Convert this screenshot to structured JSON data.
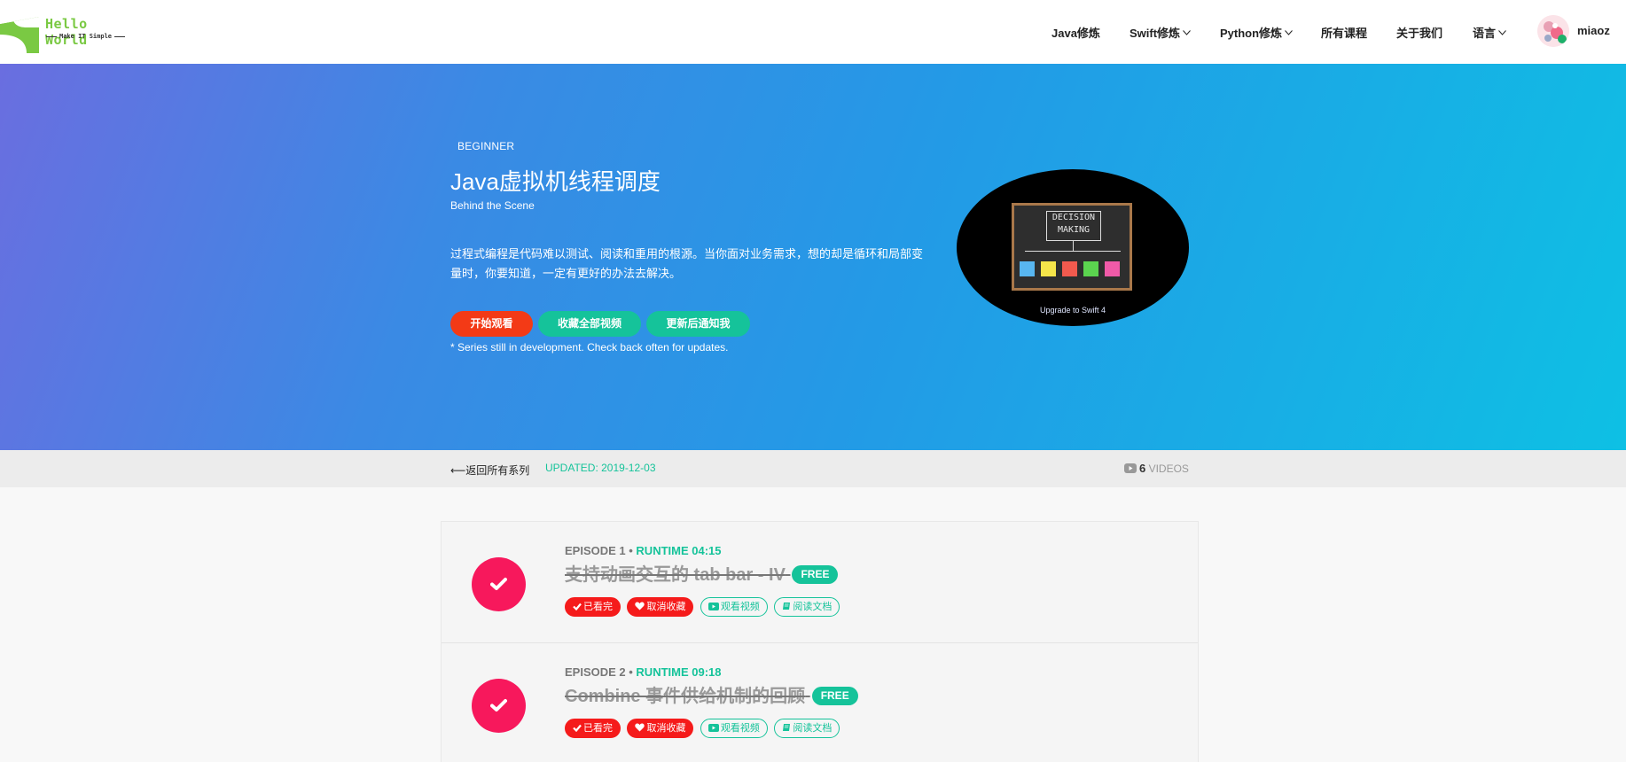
{
  "brand": {
    "name": "Hello World",
    "tagline": "Make IT Simple"
  },
  "nav": {
    "items": [
      {
        "label": "Java修炼",
        "dropdown": false
      },
      {
        "label": "Swift修炼",
        "dropdown": true
      },
      {
        "label": "Python修炼",
        "dropdown": true
      },
      {
        "label": "所有课程",
        "dropdown": false
      },
      {
        "label": "关于我们",
        "dropdown": false
      },
      {
        "label": "语言",
        "dropdown": true
      }
    ],
    "user": "miaoz"
  },
  "hero": {
    "level": "BEGINNER",
    "title": "Java虚拟机线程调度",
    "subtitle": "Behind the Scene",
    "description": "过程式编程是代码难以测试、阅读和重用的根源。当你面对业务需求，想的却是循环和局部变量时，你要知道，一定有更好的办法去解决。",
    "buttons": {
      "start": "开始观看",
      "favorite_all": "收藏全部视频",
      "notify": "更新后通知我"
    },
    "note": "* Series still in development. Check back often for updates.",
    "thumbnail": {
      "board_text": "DECISION MAKING",
      "caption": "Upgrade to Swift 4"
    }
  },
  "series_bar": {
    "back": "⟵返回所有系列",
    "updated": "UPDATED: 2019-12-03",
    "video_count": "6",
    "videos_label": "VIDEOS"
  },
  "episodes": [
    {
      "episode": "EPISODE 1",
      "runtime": "RUNTIME 04:15",
      "title": "支持动画交互的 tab bar - IV",
      "badge": "FREE",
      "actions": {
        "watched": "已看完",
        "unfavorite": "取消收藏",
        "watch": "观看视频",
        "read": "阅读文档"
      }
    },
    {
      "episode": "EPISODE 2",
      "runtime": "RUNTIME 09:18",
      "title": "Combine 事件供给机制的回顾",
      "badge": "FREE",
      "actions": {
        "watched": "已看完",
        "unfavorite": "取消收藏",
        "watch": "观看视频",
        "read": "阅读文档"
      }
    }
  ],
  "colors": {
    "accent_teal": "#15c39a",
    "accent_red": "#f33a16",
    "check_pink": "#f7185c",
    "logo_green": "#7ac943"
  }
}
